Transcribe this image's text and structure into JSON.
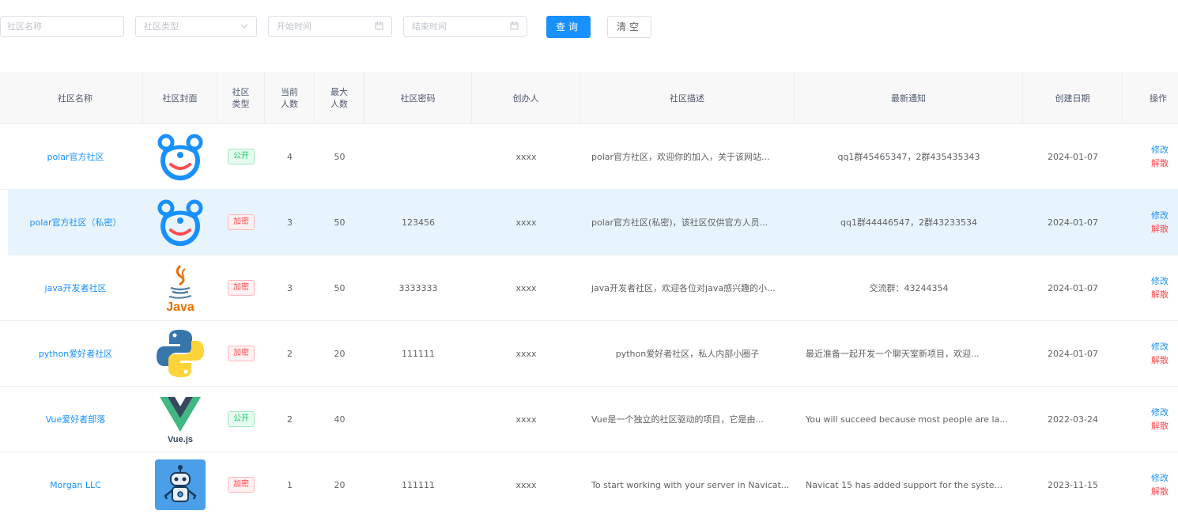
{
  "filters": {
    "name_placeholder": "社区名称",
    "type_placeholder": "社区类型",
    "start_placeholder": "开始时间",
    "end_placeholder": "结束时间",
    "query_label": "查询",
    "clear_label": "清空"
  },
  "table": {
    "columns": [
      "社区名称",
      "社区封面",
      "社区类型",
      "当前人数",
      "最大人数",
      "社区密码",
      "创办人",
      "社区描述",
      "最新通知",
      "创建日期",
      "操作"
    ],
    "header_lines": {
      "type": [
        "社区",
        "类型"
      ],
      "current": [
        "当前",
        "人数"
      ],
      "max": [
        "最大",
        "人数"
      ]
    },
    "edit_label": "修改",
    "dissolve_label": "解散",
    "rows": [
      {
        "name": "polar官方社区",
        "cover_icon": "polar-bear-logo",
        "type": "公开",
        "current": "4",
        "max": "50",
        "password": "",
        "founder": "xxxx",
        "desc": "polar官方社区，欢迎你的加入，关于该网站...",
        "notice": "qq1群45465347，2群435435343",
        "date": "2024-01-07"
      },
      {
        "name": "polar官方社区（私密）",
        "cover_icon": "polar-bear-logo",
        "type": "加密",
        "current": "3",
        "max": "50",
        "password": "123456",
        "founder": "xxxx",
        "desc": "polar官方社区(私密)，该社区仅供官方人员...",
        "notice": "qq1群44446547，2群43233534",
        "date": "2024-01-07"
      },
      {
        "name": "java开发者社区",
        "cover_icon": "java-logo",
        "type": "加密",
        "current": "3",
        "max": "50",
        "password": "3333333",
        "founder": "xxxx",
        "desc": "java开发者社区，欢迎各位对java感兴趣的小...",
        "notice": "交流群：43244354",
        "date": "2024-01-07"
      },
      {
        "name": "python爱好者社区",
        "cover_icon": "python-logo",
        "type": "加密",
        "current": "2",
        "max": "20",
        "password": "111111",
        "founder": "xxxx",
        "desc": "python爱好者社区，私人内部小圈子",
        "notice": "最近准备一起开发一个聊天室新项目，欢迎...",
        "date": "2024-01-07"
      },
      {
        "name": "Vue爱好者部落",
        "cover_icon": "vue-logo",
        "type": "公开",
        "current": "2",
        "max": "40",
        "password": "",
        "founder": "xxxx",
        "desc": "Vue是一个独立的社区驱动的项目，它是由...",
        "notice": "You will succeed because most people are la...",
        "date": "2022-03-24"
      },
      {
        "name": "Morgan LLC",
        "cover_icon": "robot-logo",
        "type": "加密",
        "current": "1",
        "max": "20",
        "password": "111111",
        "founder": "xxxx",
        "desc": "To start working with your server in Navicat...",
        "notice": "Navicat 15 has added support for the syste...",
        "date": "2023-11-15"
      }
    ]
  },
  "logo_text": {
    "java": "Java",
    "vue": "Vue.js"
  },
  "colors": {
    "primary": "#1890ff",
    "danger": "#ff4d4f",
    "success": "#13ce66",
    "row_highlight": "#e8f4fd"
  }
}
